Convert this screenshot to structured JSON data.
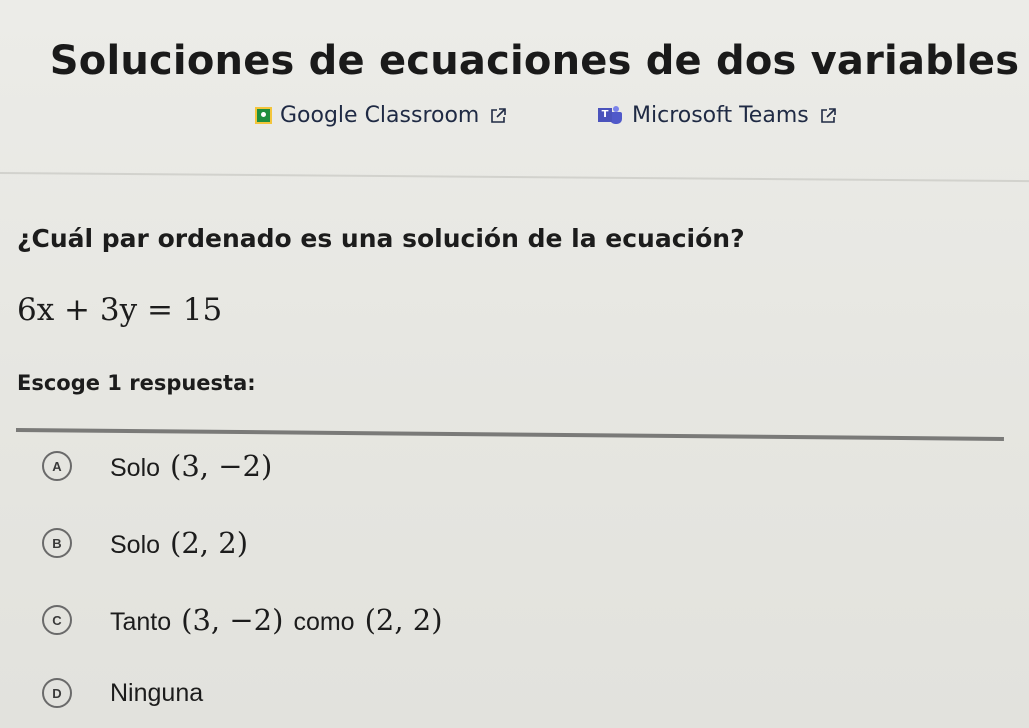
{
  "title": "Soluciones de ecuaciones de dos variables",
  "share": {
    "google_classroom": "Google Classroom",
    "microsoft_teams": "Microsoft Teams"
  },
  "question": "¿Cuál par ordenado es una solución de la ecuación?",
  "equation": "6x + 3y = 15",
  "prompt": "Escoge 1 respuesta:",
  "options": [
    {
      "letter": "A",
      "text": "Solo",
      "math": "(3, −2)"
    },
    {
      "letter": "B",
      "text": "Solo",
      "math": "(2, 2)"
    },
    {
      "letter": "C",
      "text": "Tanto",
      "math": "(3, −2)",
      "between": "como",
      "math2": "(2, 2)"
    },
    {
      "letter": "D",
      "text": "Ninguna"
    }
  ],
  "colors": {
    "background": "#e9e9e5",
    "text": "#1c1c1c",
    "link": "#1f2a44",
    "divider": "#7a7a78",
    "google_classroom_green": "#1e8e3e",
    "teams_purple": "#5059c9"
  },
  "icons": [
    "google-classroom-icon",
    "external-link-icon",
    "microsoft-teams-icon"
  ]
}
